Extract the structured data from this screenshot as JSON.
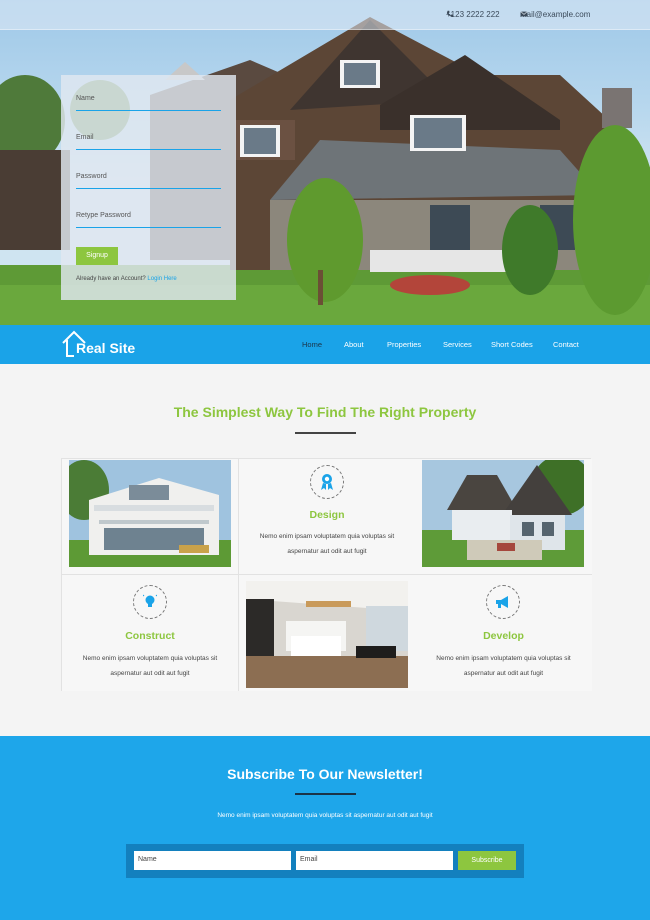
{
  "topbar": {
    "phone": "+123 2222 222",
    "email": "mail@example.com"
  },
  "signup_form": {
    "name_placeholder": "Name",
    "email_placeholder": "Email",
    "password_placeholder": "Password",
    "retype_placeholder": "Retype Password",
    "signup_label": "Signup",
    "already_text": "Already have an Account?",
    "login_link": "Login Here"
  },
  "nav": {
    "logo": "Real Site",
    "items": [
      "Home",
      "About",
      "Properties",
      "Services",
      "Short Codes",
      "Contact"
    ],
    "active": "Home"
  },
  "main": {
    "heading": "The Simplest Way To Find The Right Property",
    "features": [
      {
        "title": "Design",
        "icon": "award-ribbon-icon",
        "text_line1": "Nemo enim ipsam voluptatem quia voluptas sit",
        "text_line2": "aspernatur aut odit aut fugit"
      },
      {
        "title": "Construct",
        "icon": "lightbulb-icon",
        "text_line1": "Nemo enim ipsam voluptatem quia voluptas sit",
        "text_line2": "aspernatur aut odit aut fugit"
      },
      {
        "title": "Develop",
        "icon": "megaphone-icon",
        "text_line1": "Nemo enim ipsam voluptatem quia voluptas sit",
        "text_line2": "aspernatur aut odit aut fugit"
      }
    ]
  },
  "newsletter": {
    "title": "Subscribe To Our Newsletter!",
    "description": "Nemo enim ipsam voluptatem quia voluptas sit aspernatur aut odit aut fugit",
    "name_placeholder": "Name",
    "email_placeholder": "Email",
    "subscribe_label": "Subscribe"
  },
  "colors": {
    "accent_blue": "#1aa3e8",
    "accent_green": "#8dc63f",
    "dark": "#1b3347"
  }
}
